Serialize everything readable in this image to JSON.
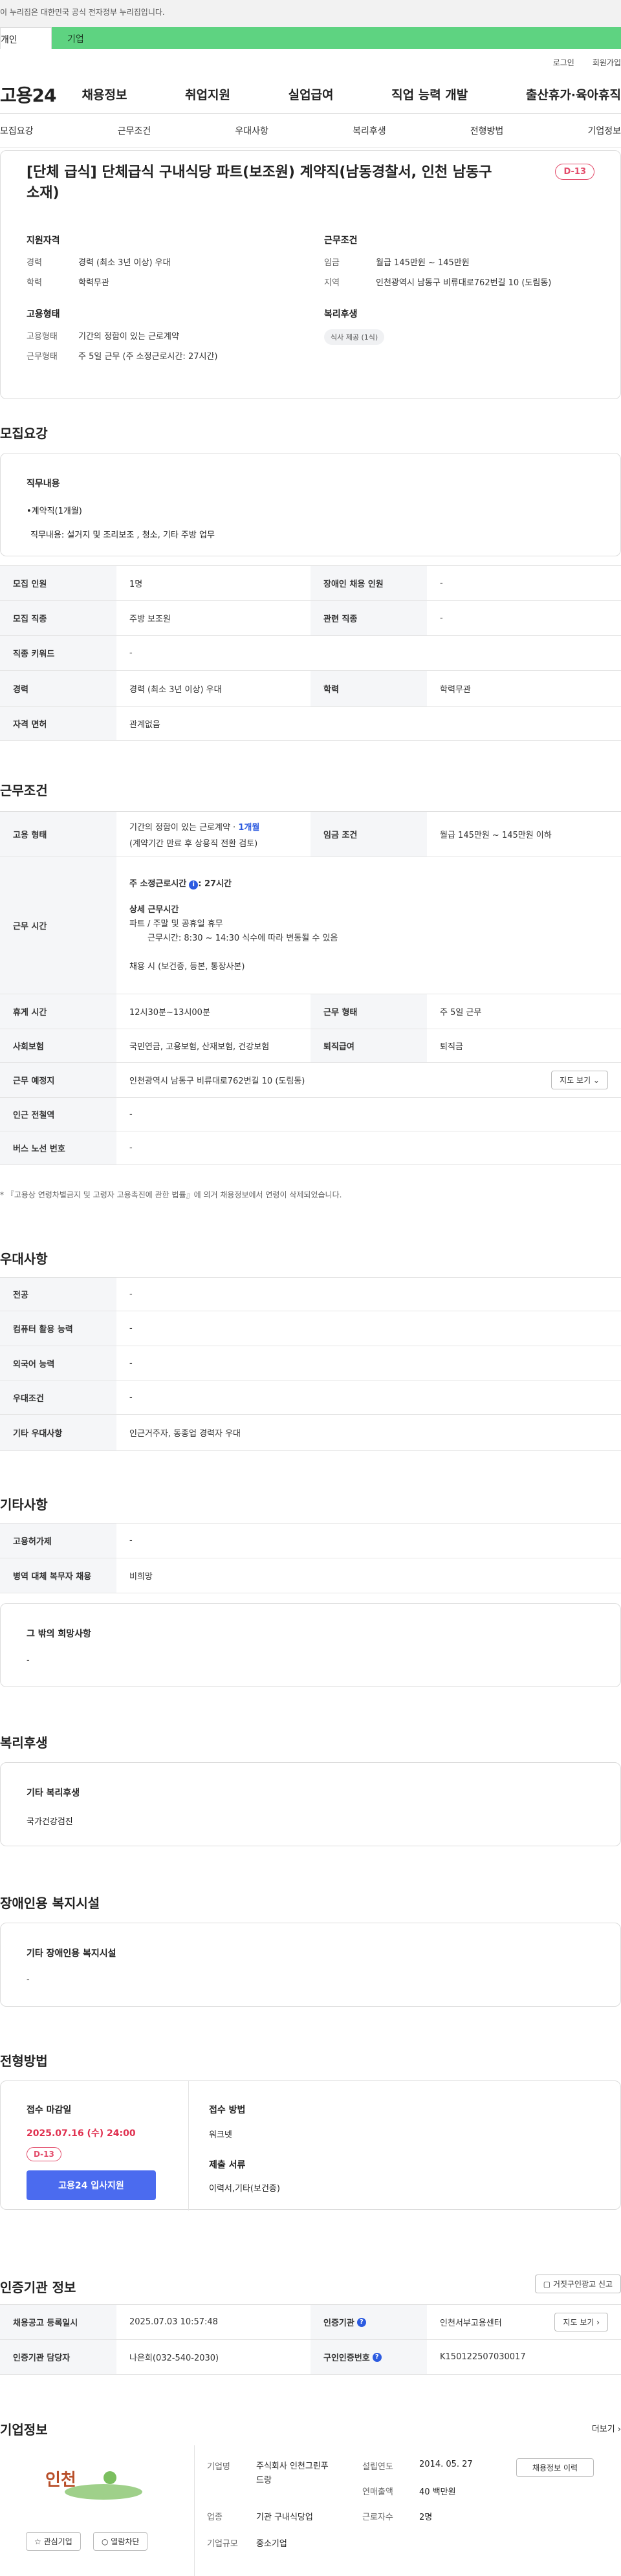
{
  "gov_notice": "이 누리집은 대한민국 공식 전자정부 누리집입니다.",
  "tabs": {
    "person": "개인",
    "company": "기업"
  },
  "util": {
    "login": "로그인",
    "join": "회원가입"
  },
  "logo": "고용24",
  "gnb": [
    "채용정보",
    "취업지원",
    "실업급여",
    "직업 능력 개발",
    "출산휴가·육아휴직"
  ],
  "anchors": [
    "모집요강",
    "근무조건",
    "우대사항",
    "복리후생",
    "전형방법",
    "기업정보"
  ],
  "summary": {
    "title": "[단체 급식] 단체급식 구내식당 파트(보조원) 계약직(남동경찰서, 인천 남동구 소재)",
    "dday": "D-13",
    "qual_title": "지원자격",
    "career_k": "경력",
    "career_v": "경력 (최소 3년 이상) 우대",
    "edu_k": "학력",
    "edu_v": "학력무관",
    "emp_title": "고용형태",
    "emp_k": "고용형태",
    "emp_v": "기간의 정함이 있는 근로계약",
    "time_k": "근무형태",
    "time_v": "주 5일 근무 (주 소정근로시간: 27시간)",
    "cond_title": "근무조건",
    "wage_k": "임금",
    "wage_v": "월급 145만원 ~ 145만원",
    "region_k": "지역",
    "region_v": "인천광역시 남동구 비류대로762번길 10 (도림동)",
    "welfare_title": "복리후생",
    "welfare_chip": "식사 제공 (1식)"
  },
  "recruit": {
    "title": "모집요강",
    "duty_title": "직무내용",
    "duty_line1": "•계약직(1개월)",
    "duty_line2": "직무내용: 설거지 및 조리보조 , 청소, 기타 주방 업무",
    "rows": {
      "count_k": "모집 인원",
      "count_v": "1명",
      "disabled_k": "장애인 채용 인원",
      "disabled_v": "-",
      "job_k": "모집 직종",
      "job_v": "주방 보조원",
      "rel_k": "관련 직종",
      "rel_v": "-",
      "kw_k": "직종 키워드",
      "kw_v": "-",
      "career_k": "경력",
      "career_v": "경력 (최소 3년 이상) 우대",
      "edu_k": "학력",
      "edu_v": "학력무관",
      "license_k": "자격 면허",
      "license_v": "관계없음"
    }
  },
  "work": {
    "title": "근무조건",
    "emp_k": "고용 형태",
    "emp_v1": "기간의 정함이 있는 근로계약 · ",
    "emp_v1b": "1개월",
    "emp_v2": "(계약기간 만료 후 상용직 전환 검토)",
    "wage_k": "임금 조건",
    "wage_v": "월급 145만원 ~ 145만원 이하",
    "time_k": "근무 시간",
    "time_l1a": "주 소정근로시간",
    "time_l1b": ": 27시간",
    "time_l2": "상세 근무시간",
    "time_l3": "파트 / 주말 및 공휴일 휴무",
    "time_l4": "근무시간: 8:30 ~ 14:30 식수에 따라 변동될 수 있음",
    "time_l5": "채용 시 (보건증, 등본, 통장사본)",
    "break_k": "휴게 시간",
    "break_v": "12시30분~13시00분",
    "form_k": "근무 형태",
    "form_v": "주 5일 근무",
    "ins_k": "사회보험",
    "ins_v": "국민연금, 고용보험, 산재보험, 건강보험",
    "sev_k": "퇴직급여",
    "sev_v": "퇴직금",
    "place_k": "근무 예정지",
    "place_v": "인천광역시 남동구 비류대로762번길 10 (도림동)",
    "map_btn": "지도 보기 ⌄",
    "subway_k": "인근 전철역",
    "subway_v": "-",
    "bus_k": "버스 노선 번호",
    "bus_v": "-",
    "note": "* 『고용상 연령차별금지 및 고령자 고용촉진에 관한 법률』에 의거 채용정보에서 연령이 삭제되었습니다."
  },
  "pref": {
    "title": "우대사항",
    "major_k": "전공",
    "major_v": "-",
    "pc_k": "컴퓨터 활용 능력",
    "pc_v": "-",
    "lang_k": "외국어 능력",
    "lang_v": "-",
    "cond_k": "우대조건",
    "cond_v": "-",
    "etc_k": "기타 우대사항",
    "etc_v": "인근거주자, 동종업 경력자 우대"
  },
  "misc": {
    "title": "기타사항",
    "lease_k": "고용허가제",
    "lease_v": "-",
    "army_k": "병역 대체 복무자 채용",
    "army_v": "비희망",
    "other_title": "그 밖의 희망사항",
    "other_v": "-"
  },
  "welfare": {
    "title": "복리후생",
    "box_title": "기타 복리후생",
    "box_v": "국가건강검진"
  },
  "facility": {
    "title": "장애인용 복지시설",
    "box_title": "기타 장애인용 복지시설",
    "box_v": "-"
  },
  "process": {
    "title": "전형방법",
    "deadline_k": "접수 마감일",
    "deadline_v": "2025.07.16 (수) 24:00",
    "dday": "D-13",
    "apply_btn": "고용24 입사지원",
    "method_k": "접수 방법",
    "method_v": "워크넷",
    "docs_k": "제출 서류",
    "docs_v": "이력서,기타(보건증)"
  },
  "cert": {
    "title": "인증기관 정보",
    "report_btn": "거짓구인광고 신고",
    "reg_k": "채용공고 등록일시",
    "reg_v": "2025.07.03 10:57:48",
    "org_k": "인증기관",
    "org_v": "인천서부고용센터",
    "map_btn": "지도 보기 ›",
    "mgr_k": "인증기관 담당자",
    "mgr_v": "나은희(032-540-2030)",
    "no_k": "구인인증번호",
    "no_v": "K150122507030017"
  },
  "company": {
    "title": "기업정보",
    "more": "더보기 ›",
    "fav_btn": "관심기업",
    "block_btn": "열람차단",
    "name_k": "기업명",
    "name_v": "주식회사 인천그린푸드랑",
    "year_k": "설립연도",
    "year_v": "2014. 05. 27",
    "hist_btn": "채용정보 이력",
    "sales_k": "연매출액",
    "sales_v": "40 백만원",
    "ind_k": "업종",
    "ind_v": "기관 구내식당업",
    "emp_k": "근로자수",
    "emp_v": "2명",
    "size_k": "기업규모",
    "size_v": "중소기업",
    "logo_text": "인천"
  }
}
